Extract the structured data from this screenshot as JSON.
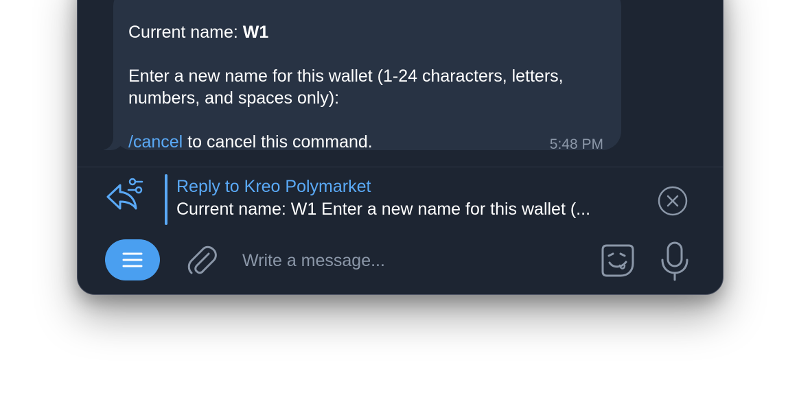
{
  "message": {
    "current_name_label": "Current name: ",
    "current_name_value": "W1",
    "prompt_line1": "Enter a new name for this wallet (1-24 characters, letters,",
    "prompt_line2": "numbers, and spaces only):",
    "cancel_link": "/cancel",
    "cancel_text": " to cancel this command.",
    "time": "5:48 PM"
  },
  "reply": {
    "title": "Reply to Kreo Polymarket",
    "preview": "Current name: W1  Enter a new name for this wallet (..."
  },
  "composer": {
    "placeholder": "Write a message..."
  },
  "icons": {
    "reply": "reply-options-icon",
    "close": "close-circle-icon",
    "menu": "menu-icon",
    "attach": "paperclip-icon",
    "sticker": "sticker-icon",
    "mic": "microphone-icon"
  },
  "colors": {
    "background": "#1d2532",
    "bubble": "#283344",
    "accent": "#5aa9f6",
    "menu_button": "#4a9ff0",
    "muted": "#8b97a8"
  }
}
